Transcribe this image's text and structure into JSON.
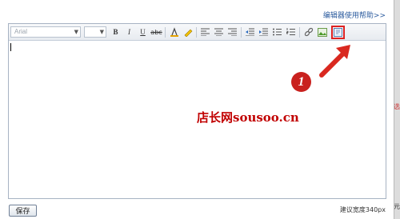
{
  "dialog": {
    "help_link": "编辑器使用帮助>>",
    "save_label": "保存",
    "width_note": "建议宽度340px"
  },
  "toolbar": {
    "font_select": {
      "value": "Arial"
    },
    "size_select": {
      "value": ""
    },
    "buttons": [
      {
        "name": "bold",
        "glyph": "B"
      },
      {
        "name": "italic",
        "glyph": "I"
      },
      {
        "name": "underline",
        "glyph": "U"
      },
      {
        "name": "strikethrough",
        "glyph": "abc"
      }
    ]
  },
  "annotation": {
    "step_number": "1",
    "watermark": "店长网sousoo.cn",
    "arrow_color": "#d9281f"
  },
  "background": {
    "glyphs": [
      "元",
      "选"
    ]
  },
  "colors": {
    "accent_red": "#c9211e",
    "link_blue": "#2b5b9e",
    "toolbar_border": "#a7b3c3"
  }
}
